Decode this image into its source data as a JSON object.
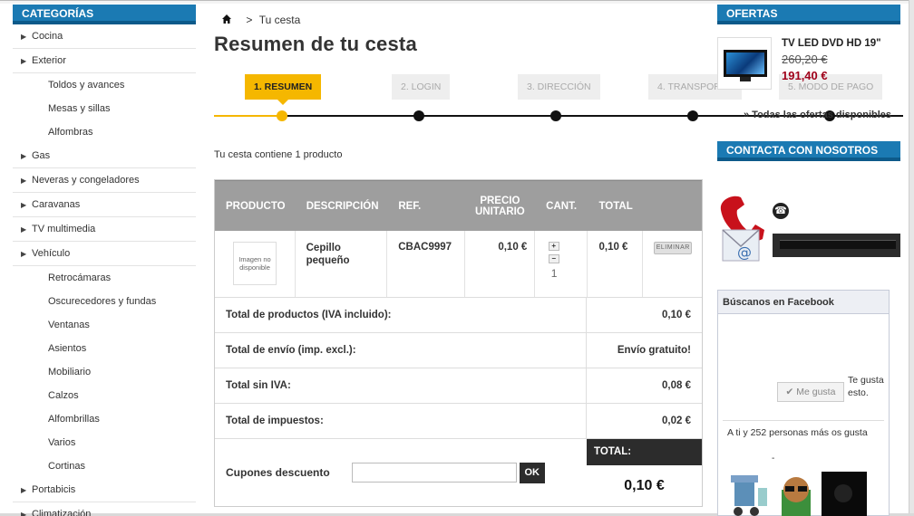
{
  "left": {
    "heading": "CATEGORÍAS",
    "categories": [
      {
        "label": "Cocina",
        "type": "cat"
      },
      {
        "label": "Exterior",
        "type": "cat"
      },
      {
        "label": "Toldos y avances",
        "type": "sub"
      },
      {
        "label": "Mesas y sillas",
        "type": "sub"
      },
      {
        "label": "Alfombras",
        "type": "sub"
      },
      {
        "label": "Gas",
        "type": "cat"
      },
      {
        "label": "Neveras y congeladores",
        "type": "cat"
      },
      {
        "label": "Caravanas",
        "type": "cat"
      },
      {
        "label": "TV multimedia",
        "type": "cat"
      },
      {
        "label": "Vehículo",
        "type": "cat"
      },
      {
        "label": "Retrocámaras",
        "type": "sub"
      },
      {
        "label": "Oscurecedores y fundas",
        "type": "sub"
      },
      {
        "label": "Ventanas",
        "type": "sub"
      },
      {
        "label": "Asientos",
        "type": "sub"
      },
      {
        "label": "Mobiliario",
        "type": "sub"
      },
      {
        "label": "Calzos",
        "type": "sub"
      },
      {
        "label": "Alfombrillas",
        "type": "sub"
      },
      {
        "label": "Varios",
        "type": "sub"
      },
      {
        "label": "Cortinas",
        "type": "sub"
      },
      {
        "label": "Portabicis",
        "type": "cat"
      },
      {
        "label": "Climatización",
        "type": "cat"
      }
    ]
  },
  "breadcrumb": {
    "separator": ">",
    "current": "Tu cesta"
  },
  "page_title": "Resumen de tu cesta",
  "steps": [
    "1. RESUMEN",
    "2. LOGIN",
    "3. DIRECCIÓN",
    "4. TRANSPORTE",
    "5. MODO DE PAGO"
  ],
  "cart": {
    "count_text": "Tu cesta contiene 1 producto",
    "headers": {
      "product": "PRODUCTO",
      "description": "DESCRIPCIÓN",
      "ref": "REF.",
      "unit_price": "PRECIO UNITARIO",
      "qty": "CANT.",
      "total": "TOTAL"
    },
    "item": {
      "image_placeholder": "Imagen no disponible",
      "description": "Cepillo pequeño",
      "ref": "CBAC9997",
      "unit_price": "0,10 €",
      "qty": "1",
      "plus": "+",
      "minus": "−",
      "total": "0,10 €",
      "delete_label": "ELIMINAR"
    },
    "summary": [
      {
        "label": "Total de productos (IVA incluido):",
        "value": "0,10 €"
      },
      {
        "label": "Total de envío (imp. excl.):",
        "value": "Envío gratuito!"
      },
      {
        "label": "Total sin IVA:",
        "value": "0,08 €"
      },
      {
        "label": "Total de impuestos:",
        "value": "0,02 €"
      }
    ],
    "coupon_label": "Cupones descuento",
    "coupon_value": "",
    "coupon_button": "OK",
    "total_label": "TOTAL:",
    "total_value": "0,10 €"
  },
  "right": {
    "offers_heading": "OFERTAS",
    "offer": {
      "title": "TV LED DVD HD 19\"",
      "old_price": "260,20 €",
      "new_price": "191,40 €"
    },
    "all_offers": "» Todas las ofertas disponibles",
    "contact_heading": "CONTACTA CON NOSOTROS",
    "facebook": {
      "heading": "Búscanos en Facebook",
      "like_button": "Me gusta",
      "like_text": "Te gusta esto.",
      "count_text": "A ti y 252 personas más os gusta",
      "dash": "-"
    }
  },
  "colors": {
    "accent_blue": "#1b7ab3",
    "step_active": "#f5b700",
    "price_red": "#a0001a",
    "dark": "#2c2c2c"
  }
}
